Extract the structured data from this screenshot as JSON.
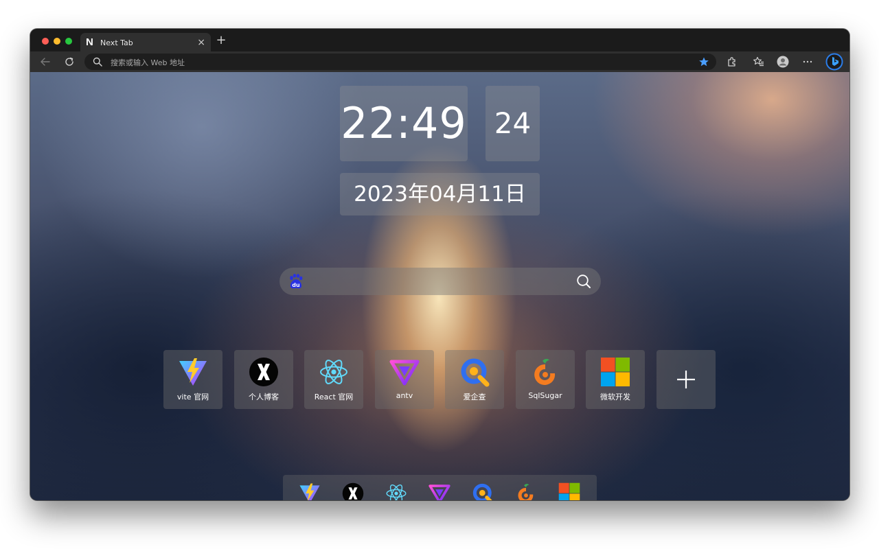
{
  "tab": {
    "title": "Next Tab",
    "favicon_letter": "N",
    "close": "×",
    "new_tab": "+"
  },
  "toolbar": {
    "address_placeholder": "搜索或输入 Web 地址",
    "icons": [
      "back-arrow-icon",
      "reload-icon",
      "search-icon",
      "star-icon",
      "extensions-icon",
      "favorites-icon",
      "profile-icon",
      "more-icon",
      "bing-icon"
    ]
  },
  "clock": {
    "time": "22:49",
    "seconds": "24",
    "date": "2023年04月11日"
  },
  "search": {
    "engine": "baidu",
    "engine_label": "du",
    "value": ""
  },
  "shortcuts": [
    {
      "label": "vite 官网",
      "icon": "vite-icon"
    },
    {
      "label": "个人博客",
      "icon": "x-logo-icon"
    },
    {
      "label": "React 官网",
      "icon": "react-icon"
    },
    {
      "label": "antv",
      "icon": "antv-icon"
    },
    {
      "label": "爱企查",
      "icon": "aiqicha-icon"
    },
    {
      "label": "SqlSugar",
      "icon": "sqlsugar-icon"
    },
    {
      "label": "微软开发",
      "icon": "microsoft-icon"
    }
  ],
  "dock": [
    "vite-icon",
    "x-logo-icon",
    "react-icon",
    "antv-icon",
    "aiqicha-icon",
    "sqlsugar-icon",
    "microsoft-icon"
  ],
  "colors": {
    "star": "#4a9eff",
    "vite_purple": "#8b5cf6",
    "vite_yellow": "#ffcb2b",
    "react": "#61dafb",
    "aiqicha_blue": "#2f6ff0",
    "aiqicha_orange": "#ffb21b",
    "sqlsugar_orange": "#f47c20",
    "ms_red": "#f25022",
    "ms_green": "#7fba00",
    "ms_blue": "#00a4ef",
    "ms_yellow": "#ffb900"
  }
}
